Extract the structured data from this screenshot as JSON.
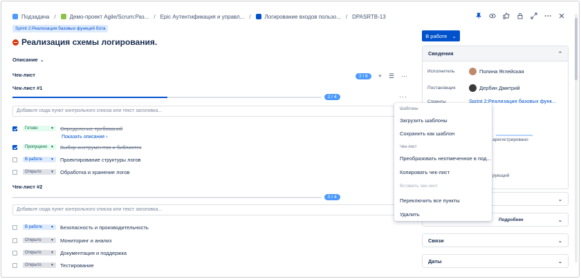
{
  "breadcrumbs": [
    {
      "label": "Подзадача",
      "color": "#4c9aff"
    },
    {
      "label": "Демо-проект Agile/Scrum:Раз...",
      "color": "#8bc34a"
    },
    {
      "label": "Epic Аутентификация и управл...",
      "color": ""
    },
    {
      "label": "Логирование входов пользо...",
      "color": "#0052cc"
    },
    {
      "label": "DPASRTB-13",
      "color": ""
    }
  ],
  "sprint_chip": "Sprint 2:Реализация базовых функций бота",
  "title": "Реализация схемы логирования.",
  "description_toggle": "Описание",
  "checklist": {
    "heading": "Чек-лист",
    "total_count": "2 / 8",
    "add_placeholder": "Добавьте сюда пункт контрольного списка или текст заголовка...",
    "lists": [
      {
        "title": "Чек-лист #1",
        "progress_label": "2 / 4",
        "progress": 0.5,
        "items": [
          {
            "status": "Готово",
            "text": "Определение требований",
            "checked": true,
            "struck": true
          },
          {
            "status": "Пропущено",
            "text": "Выбор инструментов и библиотек",
            "checked": true,
            "struck": true
          },
          {
            "status": "В работе",
            "text": "Проектирование структуры логов",
            "checked": false,
            "struck": false
          },
          {
            "status": "Открыто",
            "text": "Обработка и хранение логов",
            "checked": false,
            "struck": false
          }
        ],
        "show_description": "Показать описание ›"
      },
      {
        "title": "Чек-лист #2",
        "progress_label": "0 / 4",
        "progress": 0,
        "items": [
          {
            "status": "В работе",
            "text": "Безопасность и производительность",
            "checked": false,
            "struck": false
          },
          {
            "status": "Открыто",
            "text": "Мониторинг и анализ",
            "checked": false,
            "struck": false
          },
          {
            "status": "Открыто",
            "text": "Документация и поддержка",
            "checked": false,
            "struck": false
          },
          {
            "status": "Открыто",
            "text": "Тестирование",
            "checked": false,
            "struck": false
          }
        ]
      }
    ]
  },
  "menu": {
    "group_templates": "Шаблоны",
    "load_templates": "Загрузить шаблоны",
    "save_as_template": "Сохранить как шаблон",
    "group_checklist": "Чек-лист",
    "convert_unchecked": "Преобразовать неотмеченное в под...",
    "copy_checklist": "Копировать чек-лист",
    "paste_checklist": "Вставить чек-лист",
    "toggle_all": "Переключить все пункты",
    "delete": "Удалить"
  },
  "sidebar": {
    "status_button": "В работе",
    "details_heading": "Сведения",
    "assignee_label": "Исполнитель",
    "assignee": "Полина Яглейская",
    "reporter_label": "Постановщик",
    "reporter": "Дербин Дмитрий",
    "sprint_label": "Спринты",
    "sprint": "Sprint 2:Реализация базовых функ...",
    "partial_registered": "арегистрировано",
    "partial_current": "рующий",
    "partial_more": "Подробнее",
    "links_heading": "Связи",
    "dates_heading": "Даты"
  },
  "colors": {
    "accent": "#0052cc",
    "danger": "#de350b"
  }
}
